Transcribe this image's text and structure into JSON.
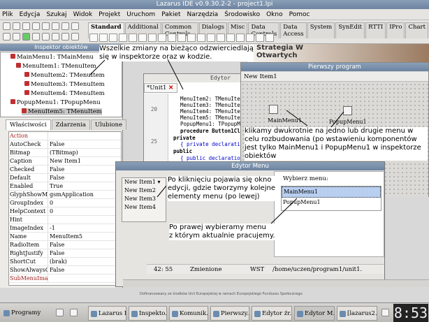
{
  "main_window": {
    "title": "Lazarus IDE v0.9.30.2-2 - project1.lpi"
  },
  "menubar": [
    "Plik",
    "Edycja",
    "Szukaj",
    "Widok",
    "Projekt",
    "Uruchom",
    "Pakiet",
    "Narzędzia",
    "Środowisko",
    "Okno",
    "Pomoc"
  ],
  "palette_tabs": [
    "Standard",
    "Additional",
    "Common Controls",
    "Dialogs",
    "Misc",
    "Data Controls",
    "Data Access",
    "System",
    "SynEdit",
    "RTTI",
    "IPro",
    "Chart"
  ],
  "inspector": {
    "title": "Inspektor obiektów",
    "tree": [
      "MainMenu1: TMainMenu",
      "MenuItem1: TMenuItem",
      "MenuItem2: TMenuItem",
      "MenuItem3: TMenuItem",
      "MenuItem4: TMenuItem",
      "PopupMenu1: TPopupMenu",
      "MenuItem5: TMenuItem"
    ],
    "tabs": [
      "Właściwości",
      "Zdarzenia",
      "Ulubione"
    ],
    "props": [
      [
        "Action",
        ""
      ],
      [
        "AutoCheck",
        "False"
      ],
      [
        "Bitmap",
        "(TBitmap)"
      ],
      [
        "Caption",
        "New Item1"
      ],
      [
        "Checked",
        "False"
      ],
      [
        "Default",
        "False"
      ],
      [
        "Enabled",
        "True"
      ],
      [
        "GlyphShowM",
        "gsmApplication"
      ],
      [
        "GroupIndex",
        "0"
      ],
      [
        "HelpContext",
        "0"
      ],
      [
        "Hint",
        ""
      ],
      [
        "ImageIndex",
        "-1"
      ],
      [
        "Name",
        "MenuItem5"
      ],
      [
        "RadioItem",
        "False"
      ],
      [
        "RightJustify",
        "False"
      ],
      [
        "ShortCut",
        "(brak)"
      ],
      [
        "ShowAlwaysC",
        "False"
      ],
      [
        "SubMenuIma",
        ""
      ]
    ]
  },
  "editor": {
    "title": "Edytor",
    "tab": "*Unit1",
    "line_numbers": [
      "20",
      "25"
    ],
    "lines": [
      "MenuItem2: TMenuItem",
      "MenuItem3: TMenuItem",
      "MenuItem4: TMenuItem",
      "MenuItem5: TMenuItem",
      "PopupMenu1: TPopupMenu",
      "procedure Button1Click",
      "private",
      "{ private declaration",
      "public",
      "{ public declaration"
    ]
  },
  "form": {
    "title": "Pierwszy program",
    "menu_item": "New Item1",
    "comp1": "MainMenu1",
    "comp2": "PopupMenu1"
  },
  "background": {
    "headline": "Strategia W\nOtwartych"
  },
  "menu_editor": {
    "title": "Edytor Menu",
    "items": [
      "New Item1",
      "New Item2",
      "New Item3",
      "New Item4"
    ],
    "right_label": "Wybierz menu:",
    "menus": [
      "MainMenu1",
      "PopupMenu1"
    ],
    "status": {
      "pos": "42: 55",
      "state": "Zmienione",
      "mode": "WST",
      "path": "/home/uczen/program1/unit1."
    }
  },
  "notes": {
    "n1": "Wszelkie zmiany na bieżąco odzwierciedlają\nsię w inspektorze oraz w kodzie.",
    "n2": "klikamy dwukrotnie na jedno lub drugie menu w\ncelu rozbudowania (po wstawieniu komponentów\njest tylko MainMenu1 i PopupMenu1 w inspektorze\nobiektów",
    "n3": "Po kliknięciu pojawia się okno\nedycji, gdzie tworzymy kolejne\nelementy menu (po lewej)",
    "n4": "Po prawej wybieramy menu\nz którym aktualnie pracujemy."
  },
  "taskbar": {
    "start": "Programy",
    "tasks": [
      "Lazarus I...",
      "Inspekto...",
      "Komunik...",
      "Pierwszy...",
      "Edytor źr...",
      "Edytor M...",
      "[lazarus2..."
    ],
    "clock": "8:53"
  },
  "footer": "Dofinansowany ze środków Unii Europejskiej w ramach Europejskiego Funduszu Społecznego"
}
